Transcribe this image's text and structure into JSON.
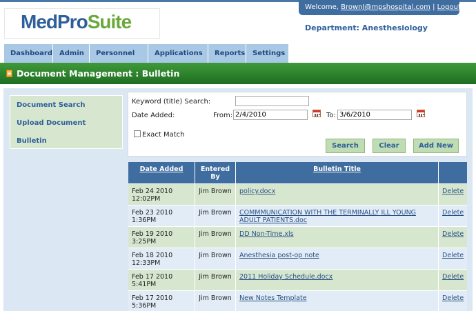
{
  "header": {
    "logo_part1": "MedPro",
    "logo_part2": "Suite",
    "welcome_prefix": "Welcome,",
    "user_email": "BrownJ@mpshospital.com",
    "separator": "|",
    "logout_label": "Logout",
    "department": "Department: Anesthesiology"
  },
  "nav": {
    "tabs": [
      {
        "label": "Dashboard"
      },
      {
        "label": "Admin"
      },
      {
        "label": "Personnel"
      },
      {
        "label": "Applications"
      },
      {
        "label": "Reports"
      },
      {
        "label": "Settings"
      }
    ]
  },
  "page_title": "Document Management : Bulletin",
  "sidebar": {
    "items": [
      {
        "label": "Document Search"
      },
      {
        "label": "Upload Document"
      },
      {
        "label": "Bulletin"
      }
    ]
  },
  "search": {
    "keyword_label": "Keyword (title) Search:",
    "keyword_value": "",
    "date_added_label": "Date Added:",
    "from_label": "From:",
    "from_value": "2/4/2010",
    "to_label": "To:",
    "to_value": "3/6/2010",
    "exact_match_label": "Exact Match",
    "search_label": "Search",
    "clear_label": "Clear",
    "add_new_label": "Add New"
  },
  "table": {
    "headers": [
      "Date Added",
      "Entered By",
      "Bulletin Title",
      ""
    ],
    "rows": [
      {
        "date_line1": "Feb 24 2010",
        "date_line2": "12:02PM",
        "entered_by": "Jim Brown",
        "title": "policy.docx",
        "action": "Delete"
      },
      {
        "date_line1": "Feb 23 2010",
        "date_line2": "1:36PM",
        "entered_by": "Jim Brown",
        "title": "COMMMUNICATION WITH THE TERMINALLY ILL YOUNG ADULT PATIENTS.doc",
        "action": "Delete"
      },
      {
        "date_line1": "Feb 19 2010",
        "date_line2": "3:25PM",
        "entered_by": "Jim Brown",
        "title": "DD Non-Time.xls",
        "action": "Delete"
      },
      {
        "date_line1": "Feb 18 2010",
        "date_line2": "12:33PM",
        "entered_by": "Jim Brown",
        "title": "Anesthesia post-op note",
        "action": "Delete"
      },
      {
        "date_line1": "Feb 17 2010",
        "date_line2": "5:41PM",
        "entered_by": "Jim Brown",
        "title": "2011 Holiday Schedule.docx",
        "action": "Delete"
      },
      {
        "date_line1": "Feb 17 2010",
        "date_line2": "5:36PM",
        "entered_by": "Jim Brown",
        "title": "New Notes Template",
        "action": "Delete"
      }
    ]
  },
  "colors": {
    "nav_blue": "#3f6d9f",
    "title_bar_green": "#2a8430",
    "row_green": "#d7e7cf",
    "row_blue": "#e1ecf6"
  }
}
